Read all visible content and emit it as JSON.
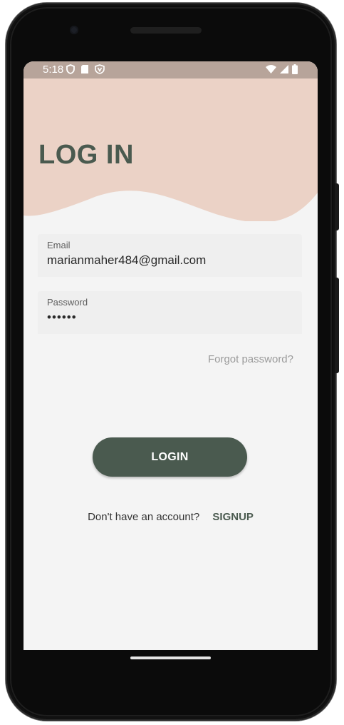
{
  "status_bar": {
    "time": "5:18",
    "left_icons": [
      "shield-icon",
      "sd-card-icon",
      "vpn-icon"
    ],
    "right_icons": [
      "wifi-icon",
      "signal-icon",
      "battery-icon"
    ],
    "color": "#b7a49a"
  },
  "header": {
    "title": "LOG IN",
    "wave_color": "#ebd2c6",
    "title_color": "#4a5a4f"
  },
  "form": {
    "email": {
      "label": "Email",
      "value": "marianmaher484@gmail.com"
    },
    "password": {
      "label": "Password",
      "value": "••••••"
    },
    "forgot_label": "Forgot password?",
    "login_label": "LOGIN",
    "no_account_text": "Don't have an account?",
    "signup_label": "SIGNUP"
  },
  "colors": {
    "accent": "#4a5a4f",
    "background": "#f4f4f4"
  }
}
